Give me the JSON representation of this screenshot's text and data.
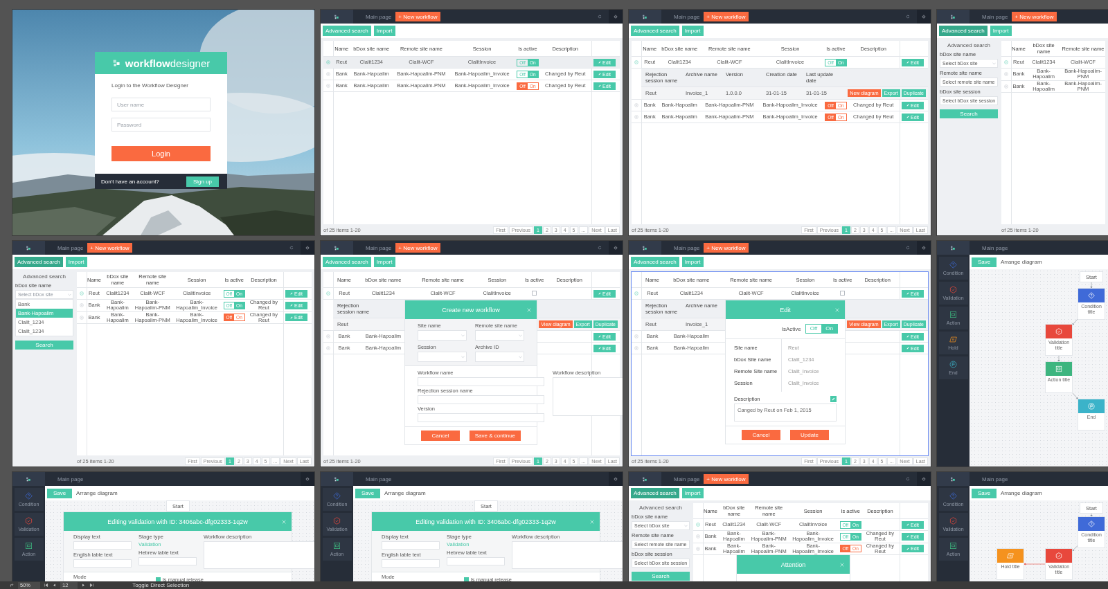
{
  "artboards": [
    {
      "kind": "login",
      "brand": {
        "bold": "workflow",
        "rest": "designer"
      },
      "subtitle": "Login to the Workflow Designer",
      "fields": [
        {
          "placeholder": "User name"
        },
        {
          "placeholder": "Password"
        }
      ],
      "login": "Login",
      "signup_prompt": "Don't have an account?",
      "signup": "Sign up"
    },
    {
      "kind": "list",
      "header": {
        "main": "Main page",
        "action": "+ New workflow"
      },
      "toolbar": [
        {
          "label": "Advanced search",
          "selected": false
        },
        {
          "label": "Import",
          "selected": false
        }
      ],
      "table": {
        "selected": false,
        "columns": [
          "Name",
          "bDox site name",
          "Remote site name",
          "Session",
          "Is active",
          "Description"
        ],
        "rows": [
          {
            "selected": true,
            "expanded": false,
            "cells": [
              "Reut",
              "Clalit1234",
              "Clalit-WCF",
              "ClalitInvoice"
            ],
            "active": {
              "kind": "toggle",
              "on": true,
              "labels": [
                "Off",
                "On"
              ]
            },
            "edit": "Edit"
          },
          {
            "selected": false,
            "expanded": false,
            "cells": [
              "Bank",
              "Bank-Hapoalim",
              "Bank-Hapoalim-PNM",
              "Bank-Hapoalim_Invoice"
            ],
            "active": {
              "kind": "toggle",
              "on": true,
              "labels": [
                "Off",
                "On"
              ]
            },
            "description": "Changed by Reut",
            "edit": "Edit"
          },
          {
            "selected": false,
            "expanded": false,
            "cells": [
              "Bank",
              "Bank-Hapoalim",
              "Bank-Hapoalim-PNM",
              "Bank-Hapoalim_Invoice"
            ],
            "active": {
              "kind": "toggle",
              "on": false,
              "labels": [
                "Off",
                "On"
              ]
            },
            "description": "Changed by Reut",
            "edit": "Edit"
          }
        ],
        "footer": "of 25 items 1-20",
        "pager": [
          {
            "label": "First",
            "selected": false
          },
          {
            "label": "Previous",
            "selected": false
          },
          {
            "label": "1",
            "selected": true
          },
          {
            "label": "2",
            "selected": false
          },
          {
            "label": "3",
            "selected": false
          },
          {
            "label": "4",
            "selected": false
          },
          {
            "label": "5",
            "selected": false
          },
          {
            "label": "...",
            "selected": false
          },
          {
            "label": "Next",
            "selected": false
          },
          {
            "label": "Last",
            "selected": false
          }
        ]
      }
    },
    {
      "kind": "list",
      "header": {
        "main": "Main page",
        "action": "+ New workflow"
      },
      "toolbar": [
        {
          "label": "Advanced search",
          "selected": false
        },
        {
          "label": "Import",
          "selected": false
        }
      ],
      "table": {
        "selected": false,
        "columns": [
          "Name",
          "bDox site name",
          "Remote site name",
          "Session",
          "Is active",
          "Description"
        ],
        "rows": [
          {
            "selected": false,
            "expanded": true,
            "cells": [
              "Reut",
              "Clalit1234",
              "Clalit-WCF",
              "ClalitInvoice"
            ],
            "active": {
              "kind": "toggle",
              "on": true,
              "labels": [
                "Off",
                "On"
              ]
            },
            "edit": "Edit",
            "detail": {
              "columns": [
                "Rejection session name",
                "Archive name",
                "Version",
                "Creation date",
                "Last update date"
              ],
              "values": [
                "Reut",
                "Invoice_1",
                "1.0.0.0",
                "31-01-15",
                "31-01-15"
              ],
              "buttons": [
                {
                  "label": "New diagram",
                  "kind": "danger"
                },
                {
                  "label": "Export",
                  "kind": "primary"
                },
                {
                  "label": "Duplicate",
                  "kind": "primary"
                }
              ]
            }
          },
          {
            "selected": false,
            "expanded": false,
            "cells": [
              "Bank",
              "Bank-Hapoalim",
              "Bank-Hapoalim-PNM",
              "Bank-Hapoalim_Invoice"
            ],
            "active": {
              "kind": "toggle",
              "on": false,
              "labels": [
                "Off",
                "On"
              ]
            },
            "description": "Changed by Reut",
            "edit": "Edit"
          },
          {
            "selected": false,
            "expanded": false,
            "cells": [
              "Bank",
              "Bank-Hapoalim",
              "Bank-Hapoalim-PNM",
              "Bank-Hapoalim_Invoice"
            ],
            "active": {
              "kind": "toggle",
              "on": false,
              "labels": [
                "Off",
                "On"
              ]
            },
            "description": "Changed by Reut",
            "edit": "Edit"
          }
        ],
        "footer": "of 25 items 1-20",
        "pager": [
          {
            "label": "First",
            "selected": false
          },
          {
            "label": "Previous",
            "selected": false
          },
          {
            "label": "1",
            "selected": true
          },
          {
            "label": "2",
            "selected": false
          },
          {
            "label": "3",
            "selected": false
          },
          {
            "label": "4",
            "selected": false
          },
          {
            "label": "5",
            "selected": false
          },
          {
            "label": "...",
            "selected": false
          },
          {
            "label": "Next",
            "selected": false
          },
          {
            "label": "Last",
            "selected": false
          }
        ]
      }
    },
    {
      "kind": "list",
      "header": {
        "main": "Main page",
        "action": "+ New workflow"
      },
      "toolbar": [
        {
          "label": "Advanced search",
          "selected": true
        },
        {
          "label": "Import",
          "selected": false
        }
      ],
      "sidebar": {
        "title": "Advanced search",
        "groups": [
          {
            "label": "bDox site name",
            "placeholder": "Select bDox site"
          },
          {
            "label": "Remote site name",
            "placeholder": "Select remote site name"
          },
          {
            "label": "bDox site session",
            "placeholder": "Select bDox site session"
          }
        ],
        "search": "Search"
      },
      "table": {
        "selected": false,
        "columns": [
          "Name",
          "bDox site name",
          "Remote site name"
        ],
        "rows": [
          {
            "selected": false,
            "expanded": true,
            "cells": [
              "Reut",
              "Clalit1234",
              "Clalit-WCF"
            ]
          },
          {
            "selected": false,
            "expanded": false,
            "cells": [
              "Bank",
              "Bank-Hapoalim",
              "Bank-Hapoalim-PNM"
            ]
          },
          {
            "selected": false,
            "expanded": false,
            "cells": [
              "Bank",
              "Bank-Hapoalim",
              "Bank-Hapoalim-PNM"
            ]
          }
        ],
        "footer": "of 25 items 1-20"
      }
    },
    {
      "kind": "list",
      "header": {
        "main": "Main page",
        "action": "+ New workflow"
      },
      "toolbar": [
        {
          "label": "Advanced search",
          "selected": true
        },
        {
          "label": "Import",
          "selected": false
        }
      ],
      "sidebar": {
        "title": "Advanced search",
        "groups": [
          {
            "label": "bDox site name",
            "placeholder": "Select bDox site",
            "options": [
              {
                "label": "Bank",
                "selected": false
              },
              {
                "label": "Bank-Hapoalim",
                "selected": true
              },
              {
                "label": "Clalit_1234",
                "selected": false
              },
              {
                "label": "Clalit_1234",
                "selected": false
              }
            ]
          }
        ],
        "search": "Search"
      },
      "table": {
        "selected": false,
        "columns": [
          "Name",
          "bDox site name",
          "Remote site name",
          "Session",
          "Is active",
          "Description"
        ],
        "rows": [
          {
            "selected": false,
            "expanded": true,
            "cells": [
              "Reut",
              "Clalit1234",
              "Clalit-WCF",
              "ClalitInvoice"
            ],
            "active": {
              "kind": "toggle",
              "on": true,
              "labels": [
                "Off",
                "On"
              ]
            },
            "edit": "Edit"
          },
          {
            "selected": false,
            "expanded": false,
            "cells": [
              "Bank",
              "Bank-Hapoalim",
              "Bank-Hapoalim-PNM",
              "Bank-Hapoalim_Invoice"
            ],
            "active": {
              "kind": "toggle",
              "on": true,
              "labels": [
                "Off",
                "On"
              ]
            },
            "description": "Changed by Reut",
            "edit": "Edit"
          },
          {
            "selected": false,
            "expanded": false,
            "cells": [
              "Bank",
              "Bank-Hapoalim",
              "Bank-Hapoalim-PNM",
              "Bank-Hapoalim_Invoice"
            ],
            "active": {
              "kind": "toggle",
              "on": false,
              "labels": [
                "Off",
                "On"
              ]
            },
            "description": "Changed by Reut",
            "edit": "Edit"
          }
        ],
        "footer": "of 25 items 1-20",
        "pager": [
          {
            "label": "First",
            "selected": false
          },
          {
            "label": "Previous",
            "selected": false
          },
          {
            "label": "1",
            "selected": true
          },
          {
            "label": "2",
            "selected": false
          },
          {
            "label": "3",
            "selected": false
          },
          {
            "label": "4",
            "selected": false
          },
          {
            "label": "5",
            "selected": false
          },
          {
            "label": "...",
            "selected": false
          },
          {
            "label": "Next",
            "selected": false
          },
          {
            "label": "Last",
            "selected": false
          }
        ]
      }
    },
    {
      "kind": "list",
      "header": {
        "main": "Main page",
        "action": "+ New workflow"
      },
      "toolbar": [
        {
          "label": "Advanced search",
          "selected": false
        },
        {
          "label": "Import",
          "selected": false
        }
      ],
      "table": {
        "selected": false,
        "columns": [
          "Name",
          "bDox site name",
          "Remote site name",
          "Session",
          "Is active",
          "Description"
        ],
        "rows": [
          {
            "selected": false,
            "expanded": true,
            "cells": [
              "Reut",
              "Clalit1234",
              "Clalit-WCF",
              "ClalitInvoice"
            ],
            "active": {
              "kind": "checkbox",
              "checked": false
            },
            "edit": "Edit",
            "detail": {
              "columns": [
                "Rejection session name"
              ],
              "values": [
                "Reut"
              ],
              "buttons": [
                {
                  "label": "View diagram",
                  "kind": "danger"
                },
                {
                  "label": "Export",
                  "kind": "primary"
                },
                {
                  "label": "Duplicate",
                  "kind": "primary"
                }
              ]
            }
          },
          {
            "selected": false,
            "expanded": false,
            "cells": [
              "Bank",
              "Bank-Hapoalim"
            ],
            "edit": "Edit"
          },
          {
            "selected": false,
            "expanded": false,
            "cells": [
              "Bank",
              "Bank-Hapoalim"
            ],
            "edit": "Edit"
          }
        ],
        "footer": "of 25 items 1-20",
        "pager": [
          {
            "label": "First",
            "selected": false
          },
          {
            "label": "Previous",
            "selected": false
          },
          {
            "label": "1",
            "selected": true
          },
          {
            "label": "2",
            "selected": false
          },
          {
            "label": "3",
            "selected": false
          },
          {
            "label": "4",
            "selected": false
          },
          {
            "label": "5",
            "selected": false
          },
          {
            "label": "...",
            "selected": false
          },
          {
            "label": "Next",
            "selected": false
          },
          {
            "label": "Last",
            "selected": false
          }
        ]
      },
      "modal": {
        "kind": "create",
        "title": "Create new workflow",
        "selects": [
          {
            "label": "Site name"
          },
          {
            "label": "Remote site name"
          },
          {
            "label": "Session"
          },
          {
            "label": "Archive ID"
          }
        ],
        "inputs": [
          {
            "label": "Workflow name"
          },
          {
            "label": "Rejection session name"
          },
          {
            "label": "Version"
          }
        ],
        "textarea": {
          "label": "Workflow description"
        },
        "buttons": [
          "Cancel",
          "Save & continue"
        ]
      }
    },
    {
      "kind": "list",
      "header": {
        "main": "Main page",
        "action": "+ New workflow"
      },
      "toolbar": [
        {
          "label": "Advanced search",
          "selected": false
        },
        {
          "label": "Import",
          "selected": false
        }
      ],
      "table": {
        "selected": true,
        "columns": [
          "Name",
          "bDox site name",
          "Remote site name",
          "Session",
          "Is active",
          "Description"
        ],
        "rows": [
          {
            "selected": false,
            "expanded": true,
            "cells": [
              "Reut",
              "Clalit1234",
              "Clalit-WCF",
              "ClalitInvoice"
            ],
            "active": {
              "kind": "checkbox",
              "checked": false
            },
            "edit": "Edit",
            "detail": {
              "columns": [
                "Rejection session name",
                "Archive name"
              ],
              "values": [
                "Reut",
                "Invoice_1"
              ],
              "buttons": [
                {
                  "label": "View diagram",
                  "kind": "danger"
                },
                {
                  "label": "Export",
                  "kind": "primary"
                },
                {
                  "label": "Duplicate",
                  "kind": "primary"
                }
              ]
            }
          },
          {
            "selected": false,
            "expanded": false,
            "cells": [
              "Bank",
              "Bank-Hapoalim"
            ],
            "edit": "Edit"
          },
          {
            "selected": false,
            "expanded": false,
            "cells": [
              "Bank",
              "Bank-Hapoalim"
            ],
            "edit": "Edit"
          }
        ],
        "footer": "of 25 items 1-20",
        "pager": [
          {
            "label": "First",
            "selected": false
          },
          {
            "label": "Previous",
            "selected": false
          },
          {
            "label": "1",
            "selected": true
          },
          {
            "label": "2",
            "selected": false
          },
          {
            "label": "3",
            "selected": false
          },
          {
            "label": "4",
            "selected": false
          },
          {
            "label": "5",
            "selected": false
          },
          {
            "label": "...",
            "selected": false
          },
          {
            "label": "Next",
            "selected": false
          },
          {
            "label": "Last",
            "selected": false
          }
        ]
      },
      "modal": {
        "kind": "edit",
        "title": "Edit",
        "switch": {
          "label": "IsActive",
          "on": true,
          "labels": [
            "Off",
            "On"
          ]
        },
        "fields": [
          {
            "label": "Site name",
            "value": "Reut"
          },
          {
            "label": "bDox Site name",
            "value": "Clalit_1234"
          },
          {
            "label": "Remote Site name",
            "value": "Clalit_Invoice"
          },
          {
            "label": "Session",
            "value": "Clalit_Invoice"
          }
        ],
        "description": {
          "label": "Description",
          "text": "Canged by Reut on Feb 1, 2015"
        },
        "buttons": [
          "Cancel",
          "Update"
        ]
      }
    },
    {
      "kind": "diagram",
      "header": {
        "main": "Main page"
      },
      "toolbar": {
        "save": "Save",
        "arrange": "Arrange diagram"
      },
      "palette": [
        {
          "kind": "condition",
          "label": "Condition"
        },
        {
          "kind": "validation",
          "label": "Validation"
        },
        {
          "kind": "action",
          "label": "Action"
        },
        {
          "kind": "hold",
          "label": "Hold"
        },
        {
          "kind": "end",
          "label": "End"
        }
      ],
      "nodes": [
        {
          "kind": "start",
          "label": "Start",
          "children": [
            {
              "kind": "condition",
              "label": "Condition title",
              "children": [
                {
                  "kind": "validation",
                  "label": "Validation title",
                  "children": [
                    {
                      "kind": "action",
                      "label": "Action title",
                      "children": [
                        {
                          "kind": "end",
                          "label": "End"
                        }
                      ]
                    }
                  ]
                }
              ]
            }
          ]
        }
      ]
    },
    {
      "kind": "diagram",
      "header": {
        "main": "Main page"
      },
      "toolbar": {
        "save": "Save",
        "arrange": "Arrange diagram"
      },
      "palette": [
        {
          "kind": "condition",
          "label": "Condition"
        },
        {
          "kind": "validation",
          "label": "Validation"
        },
        {
          "kind": "action",
          "label": "Action"
        }
      ],
      "nodes": [
        {
          "kind": "start",
          "label": "Start"
        }
      ],
      "modal": {
        "kind": "validation",
        "title": "Editing validation with ID: 3406abc-dfg02333-1q2w",
        "columns": [
          [
            {
              "kind": "input",
              "label": "Display text"
            },
            {
              "kind": "input",
              "label": "English lable text"
            }
          ],
          [
            {
              "kind": "value",
              "label": "Stage type",
              "value": "Validation"
            },
            {
              "kind": "input",
              "label": "Hebrew lable text"
            }
          ],
          [
            {
              "kind": "textarea",
              "label": "Workflow description"
            }
          ]
        ],
        "mode": "Mode",
        "checkbox": {
          "label": "Is manual release",
          "checked": true
        }
      }
    },
    {
      "kind": "diagram",
      "header": {
        "main": "Main page"
      },
      "toolbar": {
        "save": "Save",
        "arrange": "Arrange diagram"
      },
      "palette": [
        {
          "kind": "condition",
          "label": "Condition"
        },
        {
          "kind": "validation",
          "label": "Validation"
        },
        {
          "kind": "action",
          "label": "Action"
        }
      ],
      "nodes": [
        {
          "kind": "start",
          "label": "Start"
        }
      ],
      "modal": {
        "kind": "validation",
        "title": "Editing validation with ID: 3406abc-dfg02333-1q2w",
        "columns": [
          [
            {
              "kind": "input",
              "label": "Display text"
            },
            {
              "kind": "input",
              "label": "English lable text"
            }
          ],
          [
            {
              "kind": "value",
              "label": "Stage type",
              "value": "Validation"
            },
            {
              "kind": "input",
              "label": "Hebrew lable text"
            }
          ],
          [
            {
              "kind": "textarea",
              "label": "Workflow description"
            }
          ]
        ],
        "mode": "Mode",
        "checkbox": {
          "label": "Is manual release",
          "checked": true
        }
      }
    },
    {
      "kind": "list",
      "header": {
        "main": "Main page",
        "action": "+ New workflow"
      },
      "toolbar": [
        {
          "label": "Advanced search",
          "selected": true
        },
        {
          "label": "Import",
          "selected": false
        }
      ],
      "sidebar": {
        "title": "Advanced search",
        "groups": [
          {
            "label": "bDox site name",
            "placeholder": "Select bDox site"
          },
          {
            "label": "Remote site name",
            "placeholder": "Select remote site name"
          },
          {
            "label": "bDox site session",
            "placeholder": "Select bDox site session"
          }
        ],
        "search": "Search"
      },
      "table": {
        "selected": false,
        "columns": [
          "Name",
          "bDox site name",
          "Remote site name",
          "Session",
          "Is active",
          "Description"
        ],
        "rows": [
          {
            "selected": false,
            "expanded": true,
            "cells": [
              "Reut",
              "Clalit1234",
              "Clalit-WCF",
              "ClalitInvoice"
            ],
            "active": {
              "kind": "toggle",
              "on": true,
              "labels": [
                "Off",
                "On"
              ]
            },
            "edit": "Edit"
          },
          {
            "selected": false,
            "expanded": false,
            "cells": [
              "Bank",
              "Bank-Hapoalim",
              "Bank-Hapoalim-PNM",
              "Bank-Hapoalim_Invoice"
            ],
            "active": {
              "kind": "toggle",
              "on": true,
              "labels": [
                "Off",
                "On"
              ]
            },
            "description": "Changed by Reut",
            "edit": "Edit"
          },
          {
            "selected": false,
            "expanded": false,
            "cells": [
              "Bank",
              "Bank-Hapoalim",
              "Bank-Hapoalim-PNM",
              "Bank-Hapoalim_Invoice"
            ],
            "active": {
              "kind": "toggle",
              "on": false,
              "labels": [
                "Off",
                "On"
              ]
            },
            "description": "Changed by Reut",
            "edit": "Edit"
          }
        ]
      },
      "modal": {
        "kind": "attention",
        "title": "Attention"
      }
    },
    {
      "kind": "diagram",
      "header": {
        "main": "Main page"
      },
      "toolbar": {
        "save": "Save",
        "arrange": "Arrange diagram"
      },
      "palette": [
        {
          "kind": "condition",
          "label": "Condition"
        },
        {
          "kind": "validation",
          "label": "Validation"
        },
        {
          "kind": "action",
          "label": "Action"
        }
      ],
      "nodes": [
        {
          "kind": "start",
          "label": "Start",
          "children": [
            {
              "kind": "condition",
              "label": "Condition title",
              "children": [
                {
                  "kind": "validation",
                  "label": "Validation title",
                  "children": [
                    {
                      "kind": "hold",
                      "label": "Hold title"
                    }
                  ]
                }
              ]
            }
          ]
        }
      ]
    }
  ],
  "status_bar": {
    "zoom": "50%",
    "page": "12",
    "tool": "Toggle Direct Selection"
  }
}
